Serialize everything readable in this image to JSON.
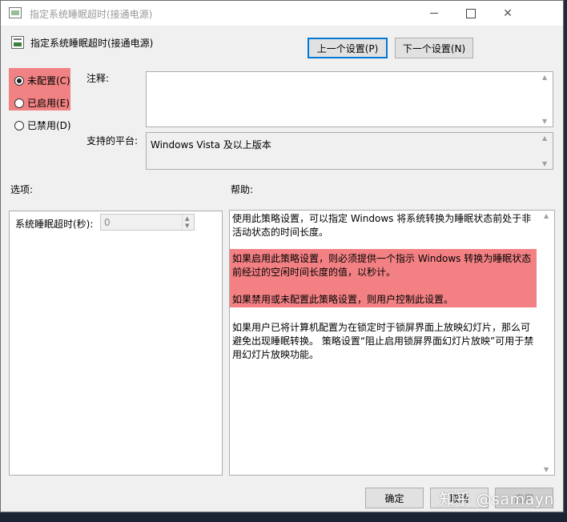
{
  "window": {
    "title": "指定系统睡眠超时(接通电源)"
  },
  "header": {
    "setting_title": "指定系统睡眠超时(接通电源)",
    "prev_button": "上一个设置(P)",
    "next_button": "下一个设置(N)"
  },
  "state": {
    "options": [
      {
        "label": "未配置(C)",
        "checked": true
      },
      {
        "label": "已启用(E)",
        "checked": false
      },
      {
        "label": "已禁用(D)",
        "checked": false
      }
    ]
  },
  "fields": {
    "comment_label": "注释:",
    "platform_label": "支持的平台:",
    "platform_value": "Windows Vista 及以上版本"
  },
  "sections": {
    "options_label": "选项:",
    "help_label": "帮助:"
  },
  "options_panel": {
    "timeout_label": "系统睡眠超时(秒):",
    "timeout_value": "0"
  },
  "help": {
    "p1": "使用此策略设置，可以指定 Windows 将系统转换为睡眠状态前处于非活动状态的时间长度。",
    "p2": "如果启用此策略设置，则必须提供一个指示 Windows 转换为睡眠状态前经过的空闲时间长度的值，以秒计。",
    "p3": "如果禁用或未配置此策略设置，则用户控制此设置。",
    "p4": "如果用户已将计算机配置为在锁定时于锁屏界面上放映幻灯片，那么可避免出现睡眠转换。 策略设置“阻止启用锁屏界面幻灯片放映”可用于禁用幻灯片放映功能。"
  },
  "footer": {
    "ok": "确定",
    "cancel": "取消",
    "apply": "应用"
  },
  "watermark": "知乎 @samayn",
  "colors": {
    "highlight": "#f08283",
    "focus_border": "#0078d7"
  }
}
